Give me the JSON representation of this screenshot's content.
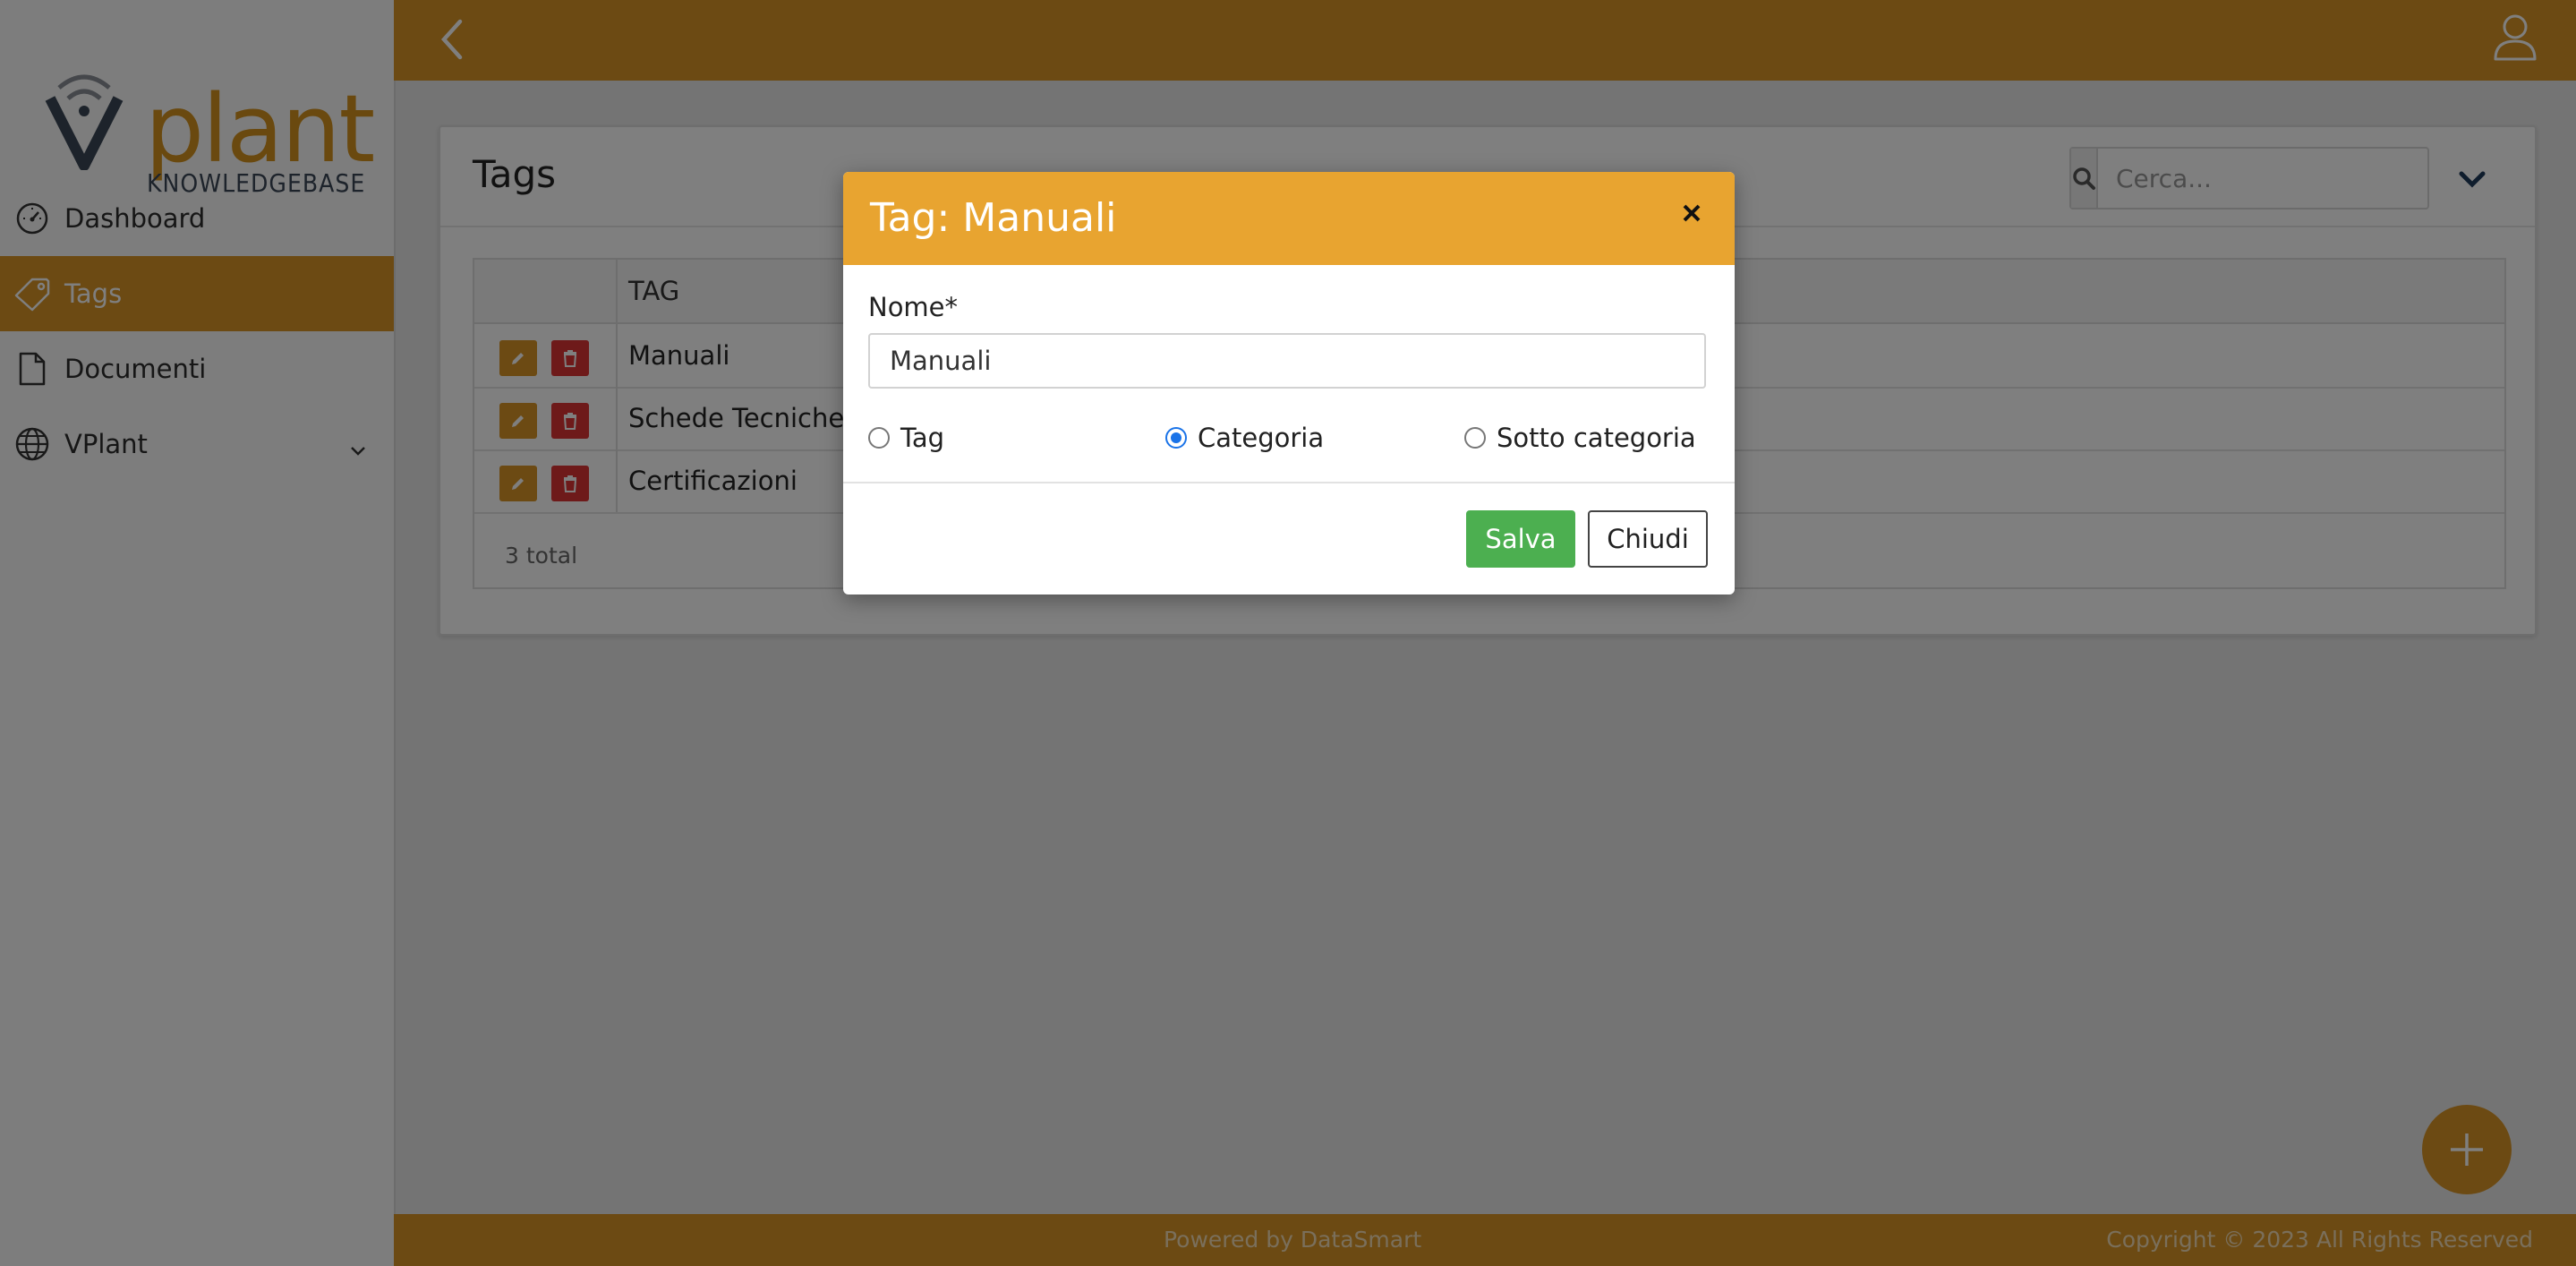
{
  "app": {
    "logo_main": "plant",
    "logo_sub": "KNOWLEDGEBASE"
  },
  "sidebar": {
    "items": [
      {
        "label": "Dashboard",
        "icon": "gauge-icon"
      },
      {
        "label": "Tags",
        "icon": "tag-icon",
        "active": true
      },
      {
        "label": "Documenti",
        "icon": "document-icon"
      },
      {
        "label": "VPlant",
        "icon": "globe-icon",
        "expandable": true
      }
    ]
  },
  "header": {
    "back_icon": "chevron-left-icon",
    "user_icon": "user-icon"
  },
  "main": {
    "title": "Tags",
    "search": {
      "placeholder": "Cerca..."
    },
    "table": {
      "columns": [
        "",
        "TAG"
      ],
      "rows": [
        {
          "name": "Manuali"
        },
        {
          "name": "Schede Tecniche"
        },
        {
          "name": "Certificazioni"
        }
      ],
      "total": "3 total"
    }
  },
  "footer": {
    "powered": "Powered by DataSmart",
    "copyright": "Copyright © 2023 All Rights Reserved"
  },
  "modal": {
    "title": "Tag: Manuali",
    "field_label": "Nome*",
    "field_value": "Manuali",
    "radios": [
      {
        "label": "Tag",
        "checked": false
      },
      {
        "label": "Categoria",
        "checked": true
      },
      {
        "label": "Sotto categoria",
        "checked": false
      }
    ],
    "save_label": "Salva",
    "close_label": "Chiudi"
  },
  "colors": {
    "brand": "#d89527",
    "modal_header": "#e8a430",
    "save": "#4caf50",
    "delete": "#dc3535"
  }
}
